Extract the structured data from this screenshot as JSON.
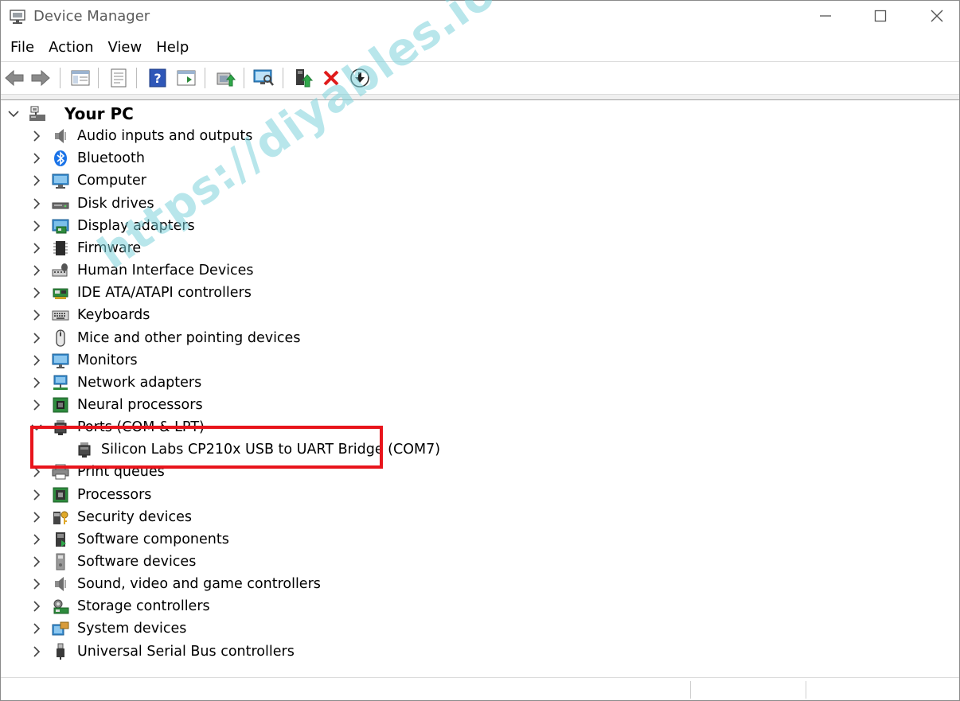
{
  "window": {
    "title": "Device Manager"
  },
  "menu": [
    "File",
    "Action",
    "View",
    "Help"
  ],
  "tree": {
    "root": "Your PC",
    "categories": [
      {
        "label": "Audio inputs and outputs",
        "icon": "speaker-icon"
      },
      {
        "label": "Bluetooth",
        "icon": "bluetooth-icon"
      },
      {
        "label": "Computer",
        "icon": "computer-icon"
      },
      {
        "label": "Disk drives",
        "icon": "disk-drive-icon"
      },
      {
        "label": "Display adapters",
        "icon": "display-adapter-icon"
      },
      {
        "label": "Firmware",
        "icon": "firmware-chip-icon"
      },
      {
        "label": "Human Interface Devices",
        "icon": "hid-icon"
      },
      {
        "label": "IDE ATA/ATAPI controllers",
        "icon": "ide-controller-icon"
      },
      {
        "label": "Keyboards",
        "icon": "keyboard-icon"
      },
      {
        "label": "Mice and other pointing devices",
        "icon": "mouse-icon"
      },
      {
        "label": "Monitors",
        "icon": "monitor-icon"
      },
      {
        "label": "Network adapters",
        "icon": "network-adapter-icon"
      },
      {
        "label": "Neural processors",
        "icon": "neural-processor-icon"
      },
      {
        "label": "Ports (COM & LPT)",
        "icon": "port-icon",
        "expanded": true,
        "children": [
          {
            "label": "Silicon Labs CP210x USB to UART Bridge (COM7)",
            "icon": "port-icon"
          }
        ]
      },
      {
        "label": "Print queues",
        "icon": "printer-icon"
      },
      {
        "label": "Processors",
        "icon": "processor-icon"
      },
      {
        "label": "Security devices",
        "icon": "security-device-icon"
      },
      {
        "label": "Software components",
        "icon": "software-component-icon"
      },
      {
        "label": "Software devices",
        "icon": "software-device-icon"
      },
      {
        "label": "Sound, video and game controllers",
        "icon": "sound-controller-icon"
      },
      {
        "label": "Storage controllers",
        "icon": "storage-controller-icon"
      },
      {
        "label": "System devices",
        "icon": "system-device-icon"
      },
      {
        "label": "Universal Serial Bus controllers",
        "icon": "usb-icon"
      }
    ]
  },
  "watermark": "https://diyables.io",
  "colors": {
    "highlight": "#e8141b",
    "watermark": "#7fd3dc"
  }
}
